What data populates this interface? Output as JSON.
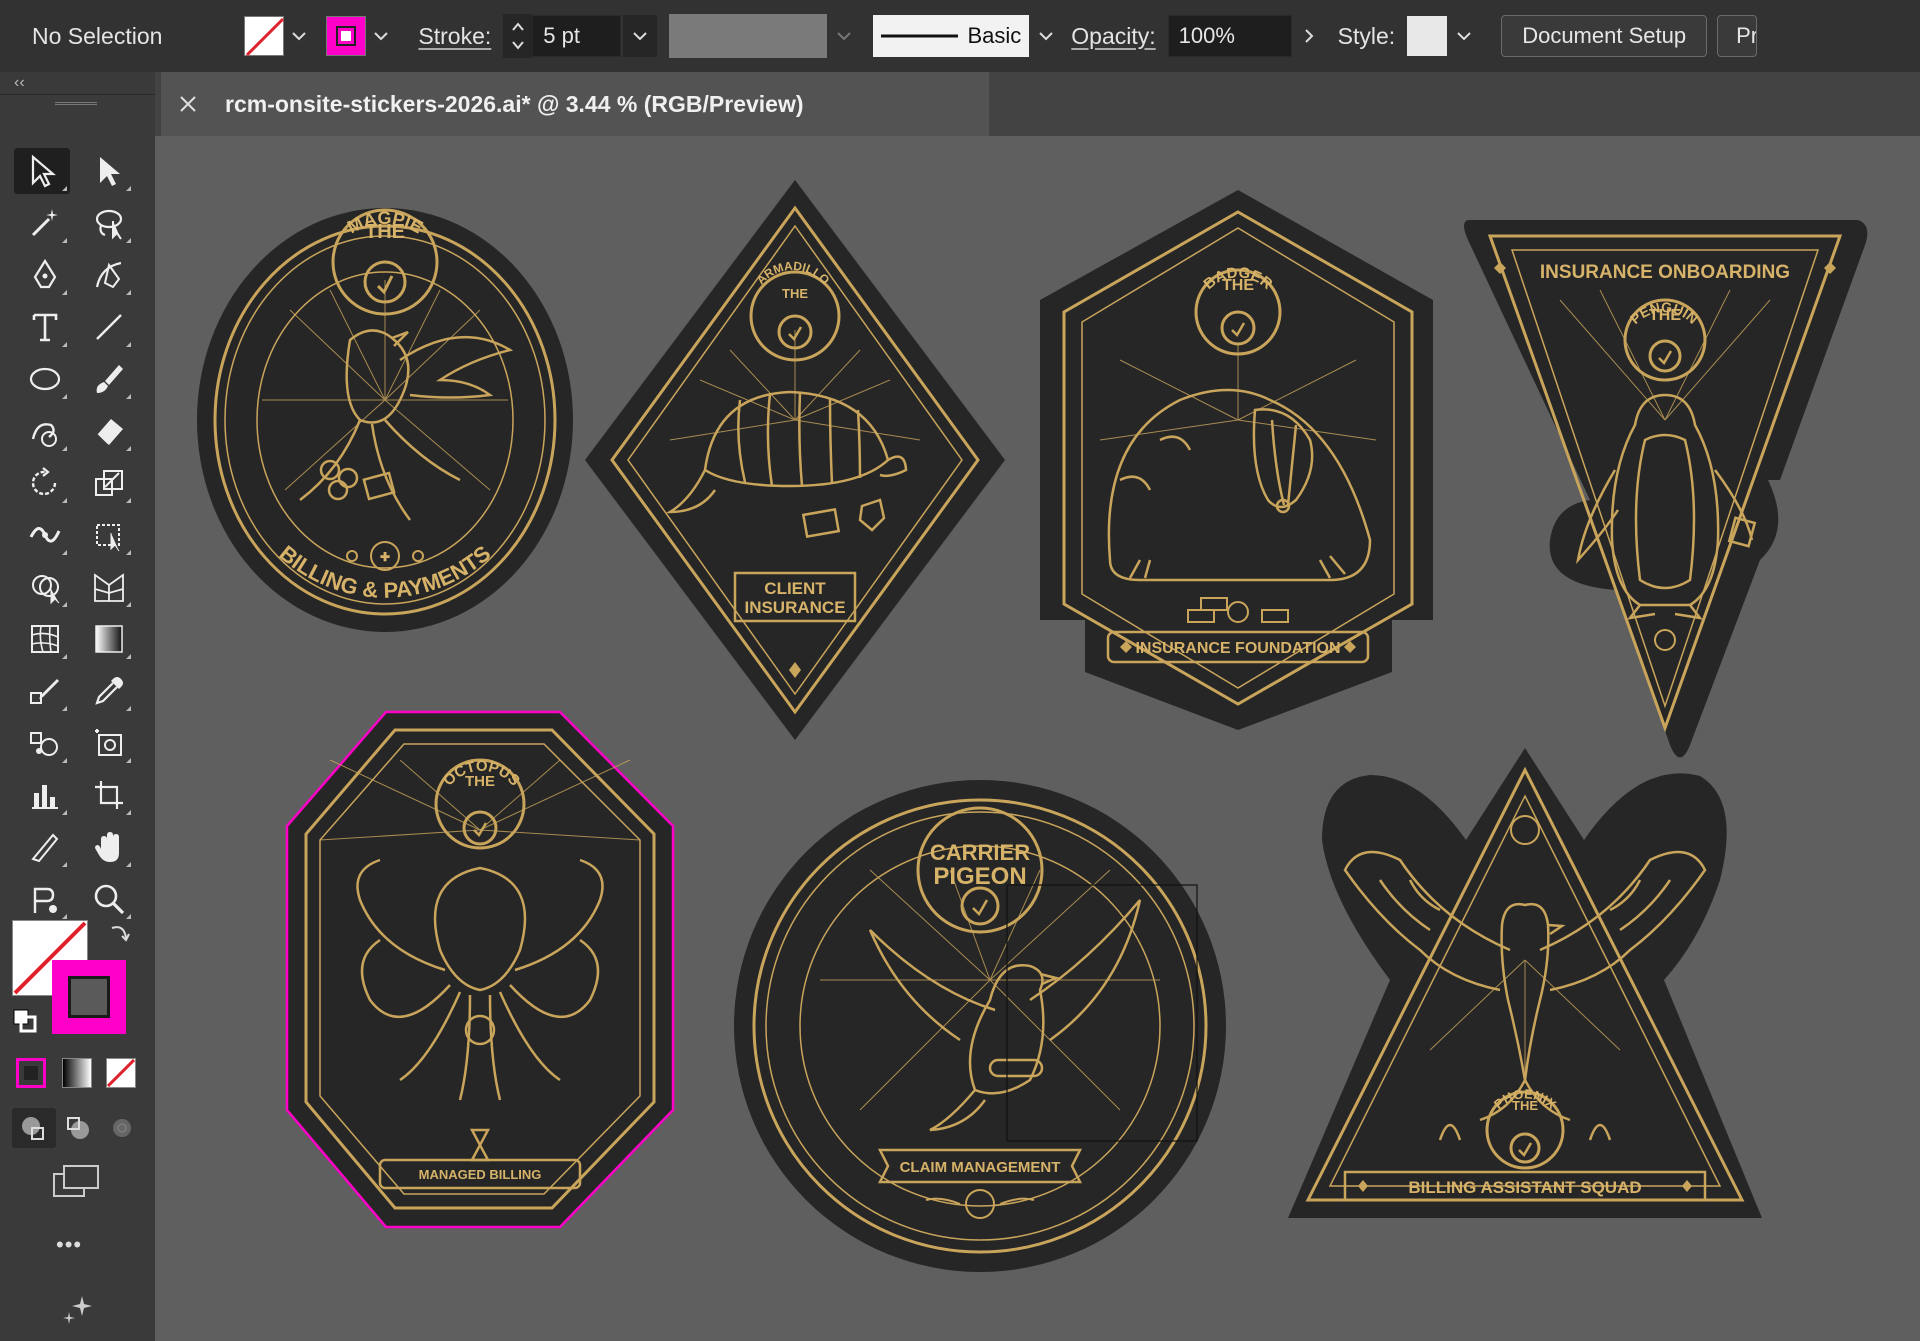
{
  "control_bar": {
    "selection_label": "No Selection",
    "stroke_label": "Stroke:",
    "stroke_weight": "5 pt",
    "brush_label": "Basic",
    "opacity_label": "Opacity:",
    "opacity_value": "100%",
    "style_label": "Style:",
    "document_setup_label": "Document Setup",
    "preferences_label": "Pr",
    "fill_color": "none",
    "stroke_color": "#ff00c8"
  },
  "tools_panel": {
    "collapse_label": "‹‹",
    "tools": [
      "selection-tool",
      "direct-selection-tool",
      "magic-wand-tool",
      "lasso-tool",
      "pen-tool",
      "curvature-tool",
      "type-tool",
      "line-segment-tool",
      "ellipse-tool",
      "paintbrush-tool",
      "shaper-tool",
      "eraser-tool",
      "rotate-tool",
      "scale-tool",
      "width-tool",
      "free-transform-tool",
      "shape-builder-tool",
      "perspective-grid-tool",
      "mesh-tool",
      "gradient-tool",
      "eyedropper-blend-tool",
      "eyedropper-tool",
      "symbol-sprayer-tool",
      "artboard-capture-tool",
      "column-graph-tool",
      "artboard-tool",
      "slice-tool",
      "hand-tool",
      "puppet-warp-tool",
      "zoom-tool"
    ],
    "more_label": "•••"
  },
  "document": {
    "tab_title": "rcm-onsite-stickers-2026.ai* @ 3.44 % (RGB/Preview)"
  },
  "stickers": {
    "magpie": {
      "top": "THE",
      "name": "MAGPIE",
      "banner": "BILLING & PAYMENTS"
    },
    "armadillo": {
      "top": "THE",
      "name": "ARMADILLO",
      "banner_line1": "CLIENT",
      "banner_line2": "INSURANCE"
    },
    "badger": {
      "top": "THE",
      "name": "BADGER",
      "banner": "INSURANCE FOUNDATION"
    },
    "penguin": {
      "header": "INSURANCE ONBOARDING",
      "top": "THE",
      "name": "PENGUIN"
    },
    "octopus": {
      "top": "THE",
      "name": "OCTOPUS",
      "banner": "MANAGED BILLING"
    },
    "pigeon": {
      "top": "CARRIER",
      "name": "PIGEON",
      "banner": "CLAIM MANAGEMENT"
    },
    "phoenix": {
      "top": "THE",
      "name": "PHOENIX",
      "banner": "BILLING ASSISTANT SQUAD"
    }
  },
  "colors": {
    "sticker_bg": "#262626",
    "gold": "#c9a55c",
    "canvas": "#5f5f5f",
    "selection": "#ff00c8"
  }
}
